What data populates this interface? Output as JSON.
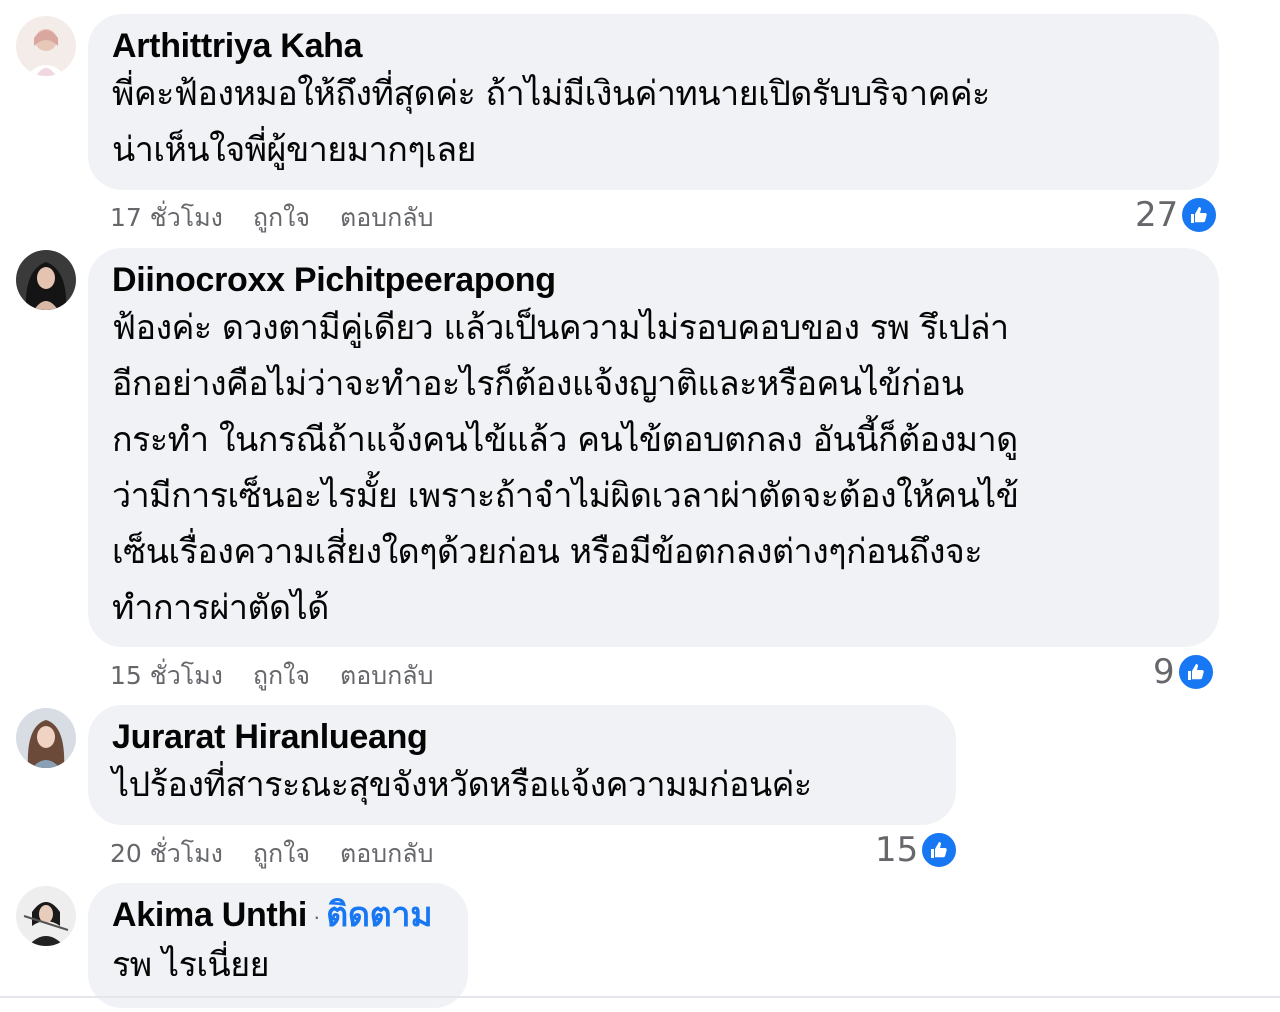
{
  "comments": [
    {
      "name": "Arthittriya Kaha",
      "lines": [
        "พี่คะฟ้องหมอให้ถึงที่สุดค่ะ ถ้าไม่มีเงินค่าทนายเปิดรับบริจาคค่ะ",
        "น่าเห็นใจพี่ผู้ขายมากๆเลย"
      ],
      "time": "17 ชั่วโมง",
      "like_label": "ถูกใจ",
      "reply_label": "ตอบกลับ",
      "reaction_count": "27",
      "reaction_icon": "like-icon",
      "avatar_color": "#e9d7d2"
    },
    {
      "name": "Diinocroxx Pichitpeerapong",
      "lines": [
        "ฟ้องค่ะ ดวงตามีคู่เดียว แล้วเป็นความไม่รอบคอบของ รพ รึเปล่า",
        "อีกอย่างคือไม่ว่าจะทำอะไรก็ต้องแจ้งญาติและหรือคนไข้ก่อน",
        "กระทำ ในกรณีถ้าแจ้งคนไข้แล้ว คนไข้ตอบตกลง อันนี้ก็ต้องมาดู",
        "ว่ามีการเซ็นอะไรมั้ย เพราะถ้าจำไม่ผิดเวลาผ่าตัดจะต้องให้คนไข้",
        "เซ็นเรื่องความเสี่ยงใดๆด้วยก่อน หรือมีข้อตกลงต่างๆก่อนถึงจะ",
        "ทำการผ่าตัดได้"
      ],
      "time": "15 ชั่วโมง",
      "like_label": "ถูกใจ",
      "reply_label": "ตอบกลับ",
      "reaction_count": "9",
      "reaction_icon": "like-icon",
      "avatar_color": "#2b2b2b"
    },
    {
      "name": "Jurarat Hiranlueang",
      "lines": [
        "ไปร้องที่สาระณะสุขจังหวัดหรือแจ้งความมก่อนค่ะ"
      ],
      "time": "20 ชั่วโมง",
      "like_label": "ถูกใจ",
      "reply_label": "ตอบกลับ",
      "reaction_count": "15",
      "reaction_icon": "like-icon",
      "avatar_color": "#c9a895"
    },
    {
      "name": "Akima Unthi",
      "follow_label": "ติดตาม",
      "separator": "·",
      "lines": [
        "รพ ไรเนี่ยย"
      ],
      "avatar_color": "#e8e8e8"
    }
  ],
  "colors": {
    "bubble": "#f0f2f5",
    "accent": "#1877f2",
    "meta": "#65676b",
    "text": "#050505"
  }
}
